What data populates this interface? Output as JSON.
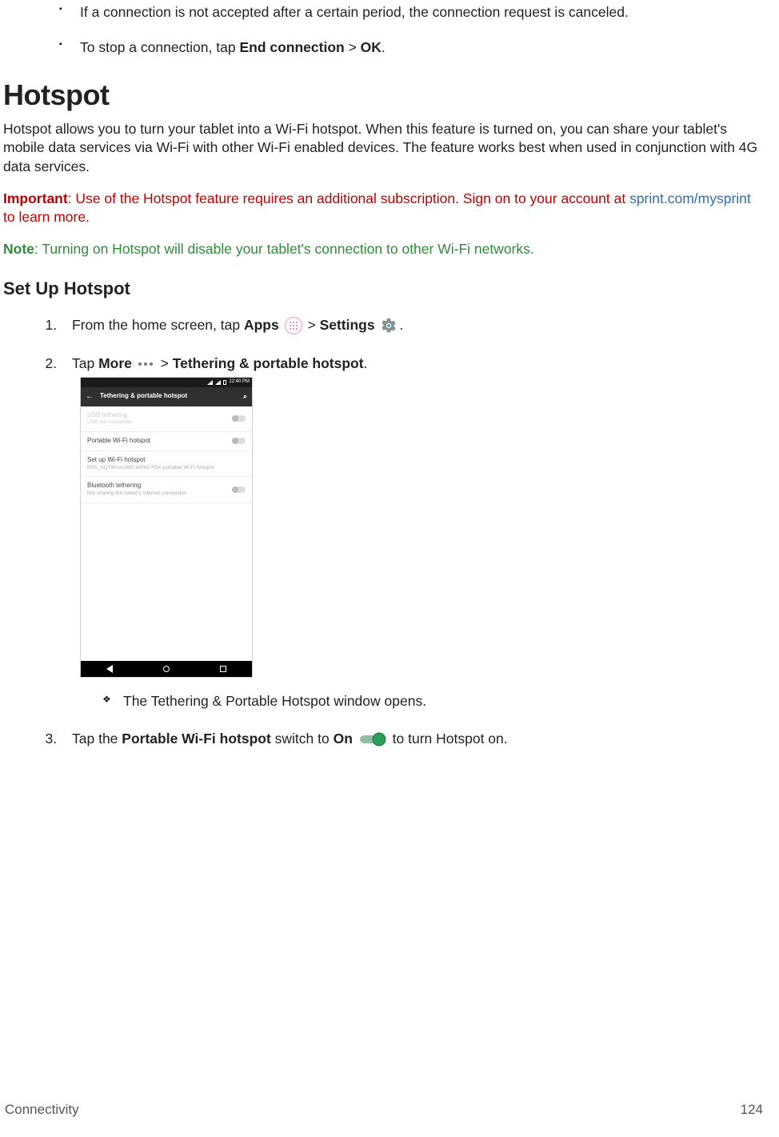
{
  "bullets": {
    "b1": "If a connection is not accepted after a certain period, the connection request is canceled.",
    "b2_pre": "To stop a connection, tap ",
    "b2_bold1": "End connection",
    "b2_mid": " > ",
    "b2_bold2": "OK",
    "b2_post": "."
  },
  "heading": "Hotspot",
  "intro": "Hotspot allows you to turn your tablet into a Wi-Fi hotspot. When this feature is turned on, you can share your tablet's mobile data services via Wi-Fi with other Wi-Fi enabled devices. The feature works best when used in conjunction with 4G data services.",
  "important": {
    "label": "Important",
    "pre": ": Use of the Hotspot feature requires an additional subscription. Sign on to your account at ",
    "link": "sprint.com/mysprint",
    "post": " to learn more."
  },
  "note": {
    "label": "Note",
    "text": ": Turning on Hotspot will disable your tablet's connection to other Wi-Fi networks."
  },
  "subhead": "Set Up Hotspot",
  "steps": {
    "s1_pre": "From the home screen, tap ",
    "s1_apps": "Apps",
    "s1_mid": " > ",
    "s1_settings": "Settings",
    "s1_post": ".",
    "s2_pre": "Tap ",
    "s2_more": "More",
    "s2_mid": " > ",
    "s2_teth": "Tethering & portable hotspot",
    "s2_post": ".",
    "s2_sub": "The Tethering & Portable Hotspot window opens.",
    "s3_pre": "Tap the ",
    "s3_bold": "Portable Wi-Fi hotspot",
    "s3_mid": " switch to ",
    "s3_on": "On",
    "s3_post": " to turn Hotspot on."
  },
  "shot": {
    "time": "12:40 PM",
    "title": "Tethering & portable hotspot",
    "r1t": "USB tethering",
    "r1s": "USB not connected",
    "r2t": "Portable Wi-Fi hotspot",
    "r3t": "Set up Wi-Fi hotspot",
    "r3s": "NX5_AQT80-ec36f3 WPA2 PSK portable Wi-Fi hotspot",
    "r4t": "Bluetooth tethering",
    "r4s": "Not sharing this tablet's Internet connection"
  },
  "footer": {
    "section": "Connectivity",
    "page": "124"
  }
}
